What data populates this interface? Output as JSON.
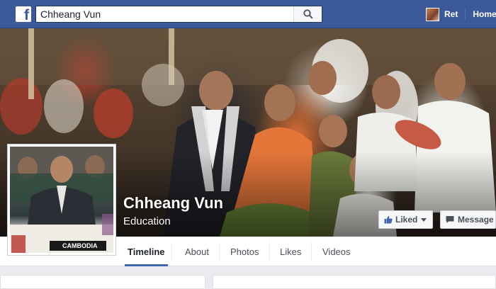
{
  "topbar": {
    "logo_letter": "f",
    "search_value": "Chheang Vun",
    "user_name": "Ret",
    "home_label": "Home"
  },
  "cover": {
    "page_name": "Chheang Vun",
    "category": "Education",
    "liked_label": "Liked",
    "message_label": "Message"
  },
  "profile_pic": {
    "sign_text": "CAMBODIA"
  },
  "tabs": [
    {
      "label": "Timeline"
    },
    {
      "label": "About"
    },
    {
      "label": "Photos"
    },
    {
      "label": "Likes"
    },
    {
      "label": "Videos"
    }
  ],
  "colors": {
    "brand": "#3b5998",
    "tab_active": "#4267b2"
  }
}
